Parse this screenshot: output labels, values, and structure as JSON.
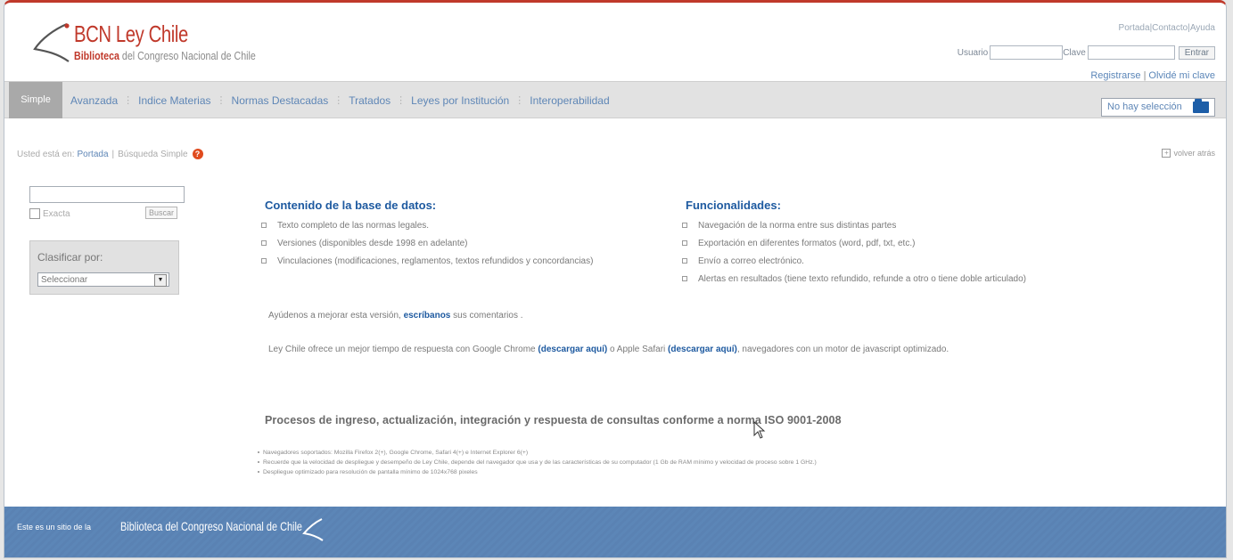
{
  "header": {
    "logo_title": "BCN Ley Chile",
    "logo_subtitle_bold": "Biblioteca",
    "logo_subtitle_rest": " del Congreso Nacional de Chile",
    "top_links": [
      "Portada",
      "Contacto",
      "Ayuda"
    ],
    "login": {
      "user_label": "Usuario",
      "password_label": "Clave",
      "submit_label": "Entrar",
      "user_value": "",
      "password_value": ""
    },
    "register_link": "Registrarse",
    "forgot_link": "Olvidé mi clave"
  },
  "nav": {
    "active_tab": "Simple",
    "tabs": [
      "Avanzada",
      "Indice Materias",
      "Normas Destacadas",
      "Tratados",
      "Leyes por Institución",
      "Interoperabilidad"
    ],
    "selection_label": "No hay selección"
  },
  "breadcrumb": {
    "prefix": "Usted está en:",
    "home": "Portada",
    "current": "Búsqueda Simple",
    "back_label": "volver atrás"
  },
  "search": {
    "query_value": "",
    "exact_label": "Exacta",
    "search_button": "Buscar",
    "classify_label": "Clasificar por:",
    "classify_selected": "Seleccionar"
  },
  "content": {
    "db_title": "Contenido de la base de datos:",
    "db_items": [
      "Texto completo de las normas legales.",
      "Versiones (disponibles desde 1998 en adelante)",
      "Vinculaciones (modificaciones, reglamentos, textos refundidos y concordancias)"
    ],
    "func_title": "Funcionalidades:",
    "func_items": [
      "Navegación de la norma entre sus distintas partes",
      "Exportación en diferentes formatos (word, pdf, txt, etc.)",
      "Envío a correo electrónico.",
      "Alertas en resultados (tiene texto refundido, refunde a otro o tiene doble articulado)"
    ],
    "feedback_pre": "Ayúdenos a mejorar esta versión, ",
    "feedback_link": "escríbanos",
    "feedback_post": " sus comentarios .",
    "browser_pre": "Ley Chile ofrece un mejor tiempo de respuesta con Google Chrome ",
    "browser_link1": "(descargar aquí)",
    "browser_mid": " o Apple Safari ",
    "browser_link2": "(descargar aquí)",
    "browser_post": ", navegadores con un motor de javascript optimizado.",
    "iso_title": "Procesos de ingreso, actualización, integración y respuesta de consultas conforme a norma ISO 9001-2008",
    "notes": [
      "Navegadores soportados: Mozilla Firefox 2(+), Google Chrome, Safari 4(+) e Internet Explorer 6(+)",
      "Recuerde que la velocidad de despliegue y desempeño de Ley Chile, depende del navegador que usa y de las características de su computador (1 Gb de RAM mínimo y velocidad de proceso sobre 1 GHz.)",
      "Despliegue optimizado para resolución de pantalla mínimo de 1024x768 pixeles"
    ]
  },
  "footer": {
    "prefix": "Este es un sitio de la",
    "name": "Biblioteca del Congreso Nacional de Chile"
  },
  "colors": {
    "brand_red": "#c0392b",
    "link_blue": "#1e5aa0",
    "footer_blue": "#5c86b7"
  }
}
